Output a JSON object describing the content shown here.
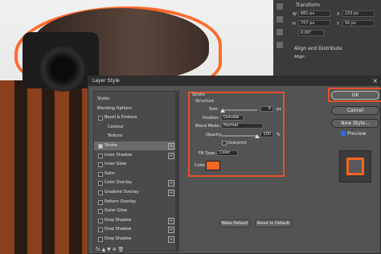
{
  "right_panel": {
    "transform_title": "Transform",
    "w_label": "W",
    "w_value": "881 px",
    "x_label": "X",
    "x_value": "233 px",
    "h_label": "H",
    "h_value": "757 px",
    "y_label": "Y",
    "y_value": "50 px",
    "angle_value": "0.00°",
    "align_title": "Align and Distribute",
    "align_label": "Align:"
  },
  "dialog": {
    "title": "Layer Style",
    "close_glyph": "×",
    "styles_list": [
      {
        "label": "Styles",
        "type": "header"
      },
      {
        "label": "Blending Options",
        "type": "header"
      },
      {
        "label": "Bevel & Emboss",
        "type": "item",
        "checkbox": true
      },
      {
        "label": "Contour",
        "type": "sub"
      },
      {
        "label": "Texture",
        "type": "sub"
      },
      {
        "label": "Stroke",
        "type": "item",
        "checkbox": true,
        "checked": true,
        "plus": true,
        "selected": true
      },
      {
        "label": "Inner Shadow",
        "type": "item",
        "checkbox": true,
        "plus": true
      },
      {
        "label": "Inner Glow",
        "type": "item",
        "checkbox": true
      },
      {
        "label": "Satin",
        "type": "item",
        "checkbox": true
      },
      {
        "label": "Color Overlay",
        "type": "item",
        "checkbox": true,
        "plus": true
      },
      {
        "label": "Gradient Overlay",
        "type": "item",
        "checkbox": true,
        "plus": true
      },
      {
        "label": "Pattern Overlay",
        "type": "item",
        "checkbox": true
      },
      {
        "label": "Outer Glow",
        "type": "item",
        "checkbox": true
      },
      {
        "label": "Drop Shadow",
        "type": "item",
        "checkbox": true,
        "plus": true
      },
      {
        "label": "Drop Shadow",
        "type": "item",
        "checkbox": true,
        "plus": true
      },
      {
        "label": "Drop Shadow",
        "type": "item",
        "checkbox": true,
        "plus": true
      }
    ],
    "bottom_icons": "fx  ▲  ▼  ⊕  🗑",
    "stroke": {
      "title": "Stroke",
      "structure_title": "Structure",
      "size_label": "Size:",
      "size_value": "6",
      "size_unit": "px",
      "position_label": "Position:",
      "position_value": "Outside",
      "blend_label": "Blend Mode:",
      "blend_value": "Normal",
      "opacity_label": "Opacity:",
      "opacity_value": "100",
      "opacity_unit": "%",
      "overprint_label": "Overprint",
      "fill_type_label": "Fill Type:",
      "fill_type_value": "Color",
      "color_label": "Color:",
      "color_hex": "#f26522"
    },
    "make_default": "Make Default",
    "reset_default": "Reset to Default",
    "buttons": {
      "ok": "OK",
      "cancel": "Cancel",
      "new_style": "New Style..."
    },
    "preview_label": "Preview",
    "accent": "#e8502a"
  }
}
